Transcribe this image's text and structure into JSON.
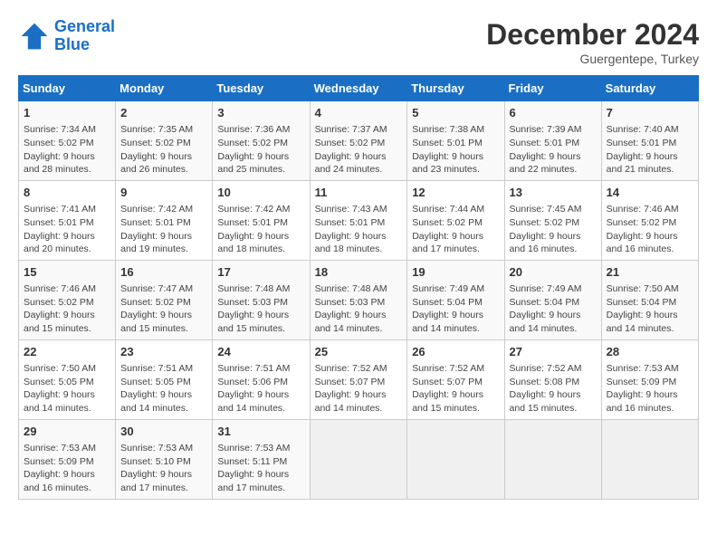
{
  "logo": {
    "line1": "General",
    "line2": "Blue"
  },
  "title": "December 2024",
  "location": "Guergentepe, Turkey",
  "headers": [
    "Sunday",
    "Monday",
    "Tuesday",
    "Wednesday",
    "Thursday",
    "Friday",
    "Saturday"
  ],
  "weeks": [
    [
      {
        "day": "1",
        "sunrise": "7:34 AM",
        "sunset": "5:02 PM",
        "daylight": "9 hours and 28 minutes."
      },
      {
        "day": "2",
        "sunrise": "7:35 AM",
        "sunset": "5:02 PM",
        "daylight": "9 hours and 26 minutes."
      },
      {
        "day": "3",
        "sunrise": "7:36 AM",
        "sunset": "5:02 PM",
        "daylight": "9 hours and 25 minutes."
      },
      {
        "day": "4",
        "sunrise": "7:37 AM",
        "sunset": "5:02 PM",
        "daylight": "9 hours and 24 minutes."
      },
      {
        "day": "5",
        "sunrise": "7:38 AM",
        "sunset": "5:01 PM",
        "daylight": "9 hours and 23 minutes."
      },
      {
        "day": "6",
        "sunrise": "7:39 AM",
        "sunset": "5:01 PM",
        "daylight": "9 hours and 22 minutes."
      },
      {
        "day": "7",
        "sunrise": "7:40 AM",
        "sunset": "5:01 PM",
        "daylight": "9 hours and 21 minutes."
      }
    ],
    [
      {
        "day": "8",
        "sunrise": "7:41 AM",
        "sunset": "5:01 PM",
        "daylight": "9 hours and 20 minutes."
      },
      {
        "day": "9",
        "sunrise": "7:42 AM",
        "sunset": "5:01 PM",
        "daylight": "9 hours and 19 minutes."
      },
      {
        "day": "10",
        "sunrise": "7:42 AM",
        "sunset": "5:01 PM",
        "daylight": "9 hours and 18 minutes."
      },
      {
        "day": "11",
        "sunrise": "7:43 AM",
        "sunset": "5:01 PM",
        "daylight": "9 hours and 18 minutes."
      },
      {
        "day": "12",
        "sunrise": "7:44 AM",
        "sunset": "5:02 PM",
        "daylight": "9 hours and 17 minutes."
      },
      {
        "day": "13",
        "sunrise": "7:45 AM",
        "sunset": "5:02 PM",
        "daylight": "9 hours and 16 minutes."
      },
      {
        "day": "14",
        "sunrise": "7:46 AM",
        "sunset": "5:02 PM",
        "daylight": "9 hours and 16 minutes."
      }
    ],
    [
      {
        "day": "15",
        "sunrise": "7:46 AM",
        "sunset": "5:02 PM",
        "daylight": "9 hours and 15 minutes."
      },
      {
        "day": "16",
        "sunrise": "7:47 AM",
        "sunset": "5:02 PM",
        "daylight": "9 hours and 15 minutes."
      },
      {
        "day": "17",
        "sunrise": "7:48 AM",
        "sunset": "5:03 PM",
        "daylight": "9 hours and 15 minutes."
      },
      {
        "day": "18",
        "sunrise": "7:48 AM",
        "sunset": "5:03 PM",
        "daylight": "9 hours and 14 minutes."
      },
      {
        "day": "19",
        "sunrise": "7:49 AM",
        "sunset": "5:04 PM",
        "daylight": "9 hours and 14 minutes."
      },
      {
        "day": "20",
        "sunrise": "7:49 AM",
        "sunset": "5:04 PM",
        "daylight": "9 hours and 14 minutes."
      },
      {
        "day": "21",
        "sunrise": "7:50 AM",
        "sunset": "5:04 PM",
        "daylight": "9 hours and 14 minutes."
      }
    ],
    [
      {
        "day": "22",
        "sunrise": "7:50 AM",
        "sunset": "5:05 PM",
        "daylight": "9 hours and 14 minutes."
      },
      {
        "day": "23",
        "sunrise": "7:51 AM",
        "sunset": "5:05 PM",
        "daylight": "9 hours and 14 minutes."
      },
      {
        "day": "24",
        "sunrise": "7:51 AM",
        "sunset": "5:06 PM",
        "daylight": "9 hours and 14 minutes."
      },
      {
        "day": "25",
        "sunrise": "7:52 AM",
        "sunset": "5:07 PM",
        "daylight": "9 hours and 14 minutes."
      },
      {
        "day": "26",
        "sunrise": "7:52 AM",
        "sunset": "5:07 PM",
        "daylight": "9 hours and 15 minutes."
      },
      {
        "day": "27",
        "sunrise": "7:52 AM",
        "sunset": "5:08 PM",
        "daylight": "9 hours and 15 minutes."
      },
      {
        "day": "28",
        "sunrise": "7:53 AM",
        "sunset": "5:09 PM",
        "daylight": "9 hours and 16 minutes."
      }
    ],
    [
      {
        "day": "29",
        "sunrise": "7:53 AM",
        "sunset": "5:09 PM",
        "daylight": "9 hours and 16 minutes."
      },
      {
        "day": "30",
        "sunrise": "7:53 AM",
        "sunset": "5:10 PM",
        "daylight": "9 hours and 17 minutes."
      },
      {
        "day": "31",
        "sunrise": "7:53 AM",
        "sunset": "5:11 PM",
        "daylight": "9 hours and 17 minutes."
      },
      null,
      null,
      null,
      null
    ]
  ]
}
